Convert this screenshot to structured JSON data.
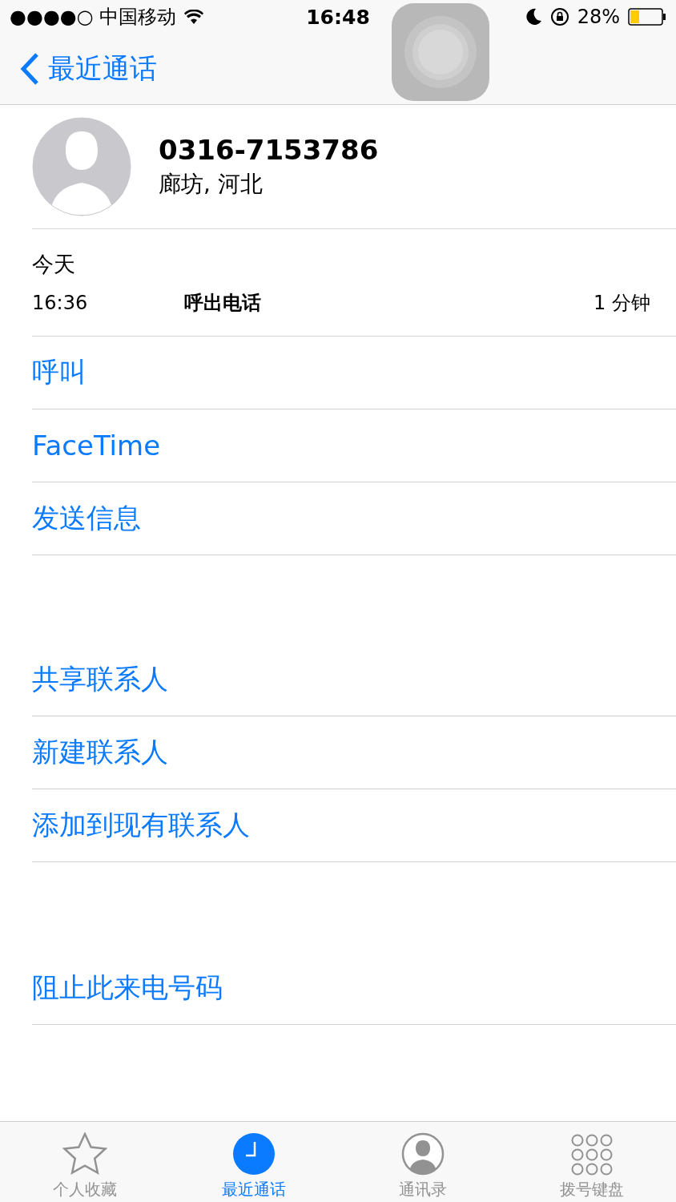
{
  "status_bar": {
    "carrier": "●●●●○ 中国移动",
    "time": "16:48",
    "battery": "28%"
  },
  "nav": {
    "back": "最近通话"
  },
  "contact": {
    "number": "0316-7153786",
    "location": "廊坊, 河北"
  },
  "call_log": {
    "date": "今天",
    "entries": [
      {
        "time": "16:36",
        "type": "呼出电话",
        "duration": "1 分钟"
      }
    ]
  },
  "action_groups": [
    [
      "呼叫",
      "FaceTime",
      "发送信息"
    ],
    [
      "共享联系人",
      "新建联系人",
      "添加到现有联系人"
    ],
    [
      "阻止此来电号码"
    ]
  ],
  "tab_bar": [
    {
      "label": "个人收藏",
      "selected": false
    },
    {
      "label": "最近通话",
      "selected": true
    },
    {
      "label": "通讯录",
      "selected": false
    },
    {
      "label": "拨号键盘",
      "selected": false
    }
  ]
}
